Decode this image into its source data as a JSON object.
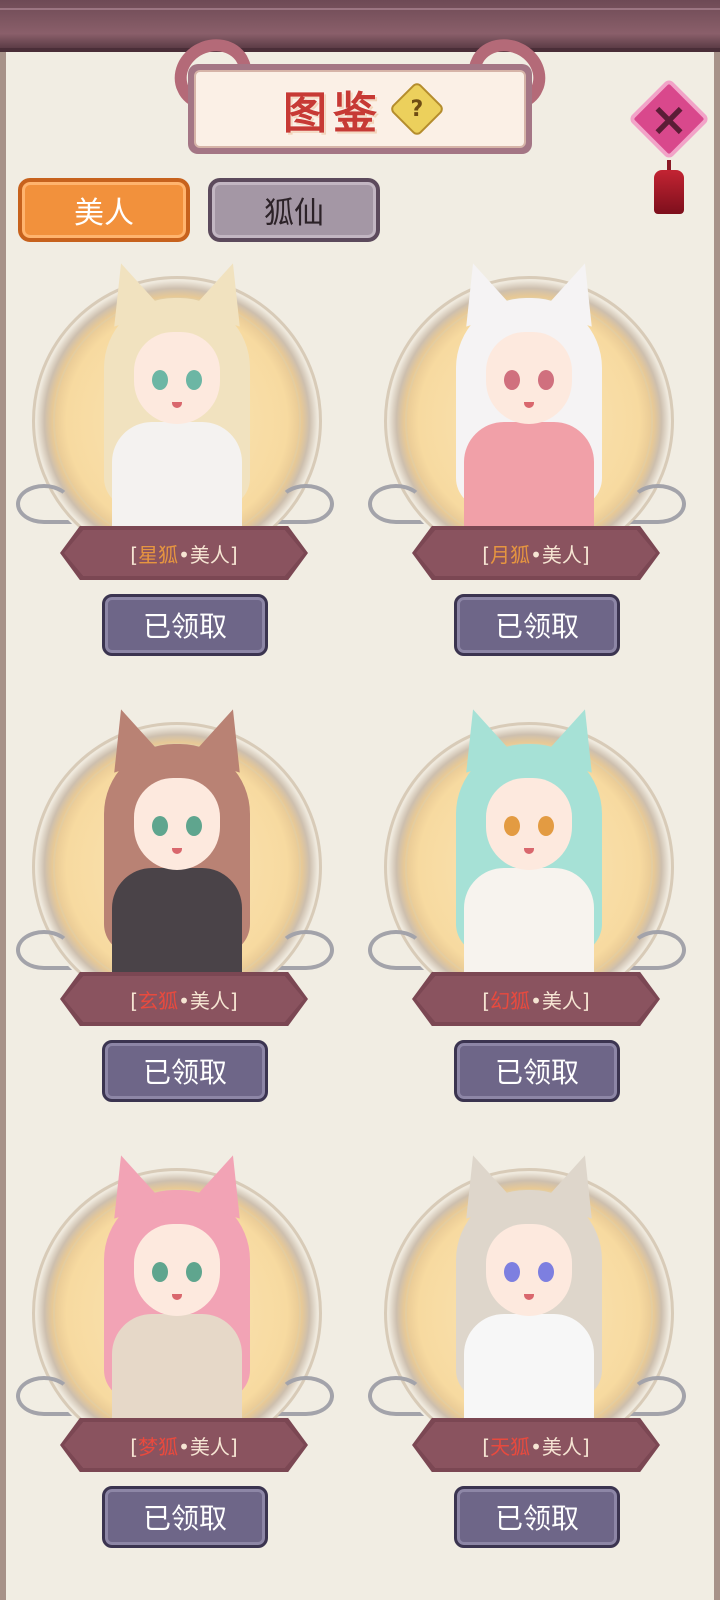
{
  "title": {
    "text": "图鉴",
    "help_icon": "?"
  },
  "close": {
    "icon": "×"
  },
  "tabs": [
    {
      "label": "美人",
      "active": true
    },
    {
      "label": "狐仙",
      "active": false
    }
  ],
  "cards": [
    {
      "fox": "星狐",
      "suffix": "美人",
      "open": "[",
      "close": "]",
      "dot": "•",
      "button": "已领取",
      "hair": "#f1e2bf",
      "eye": "#6cb6a4",
      "cloth": "#f4f2f0"
    },
    {
      "fox": "月狐",
      "suffix": "美人",
      "open": "[",
      "close": "]",
      "dot": "•",
      "button": "已领取",
      "hair": "#f5f3f4",
      "eye": "#d0707e",
      "cloth": "#f1a0a8"
    },
    {
      "fox": "玄狐",
      "suffix": "美人",
      "open": "[",
      "close": "]",
      "dot": "•",
      "button": "已领取",
      "hair": "#b98274",
      "eye": "#5fa58e",
      "cloth": "#4a4348"
    },
    {
      "fox": "幻狐",
      "suffix": "美人",
      "open": "[",
      "close": "]",
      "dot": "•",
      "button": "已领取",
      "hair": "#a6e1d6",
      "eye": "#e39b42",
      "cloth": "#f7f3ee"
    },
    {
      "fox": "梦狐",
      "suffix": "美人",
      "open": "[",
      "close": "]",
      "dot": "•",
      "button": "已领取",
      "hair": "#f2a3b5",
      "eye": "#5fa58e",
      "cloth": "#e6d8c8"
    },
    {
      "fox": "天狐",
      "suffix": "美人",
      "open": "[",
      "close": "]",
      "dot": "•",
      "button": "已领取",
      "hair": "#ded6cb",
      "eye": "#7d7fe0",
      "cloth": "#f7f7f7"
    }
  ]
}
